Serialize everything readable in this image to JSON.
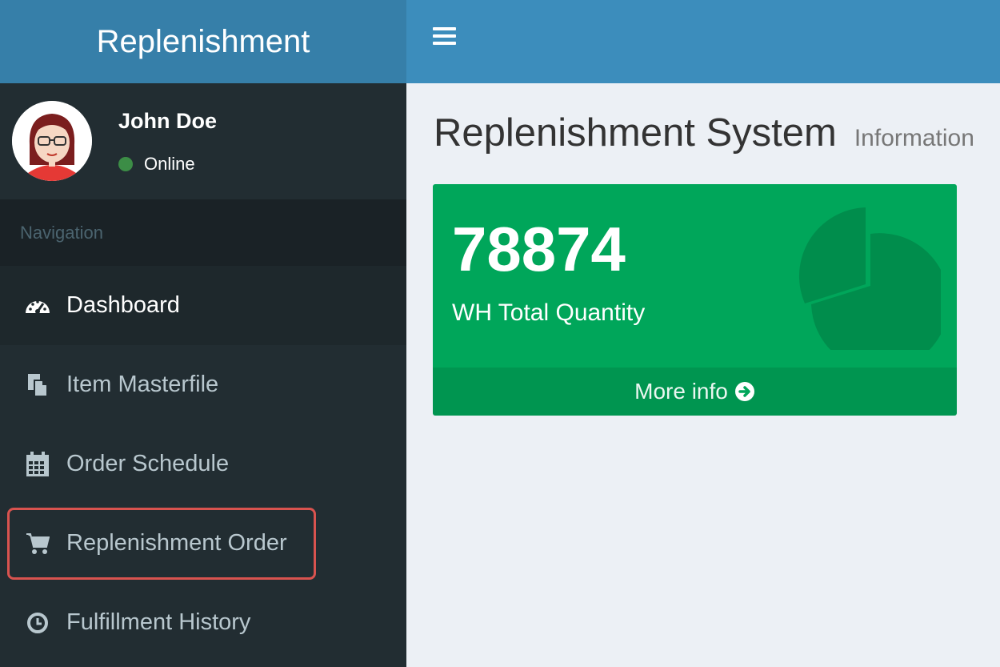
{
  "header": {
    "logo_text": "Replenishment"
  },
  "user": {
    "name": "John Doe",
    "status": "Online"
  },
  "sidebar": {
    "section_header": "Navigation",
    "items": [
      {
        "label": "Dashboard",
        "icon": "dashboard-icon"
      },
      {
        "label": "Item Masterfile",
        "icon": "files-icon"
      },
      {
        "label": "Order Schedule",
        "icon": "calendar-icon"
      },
      {
        "label": "Replenishment Order",
        "icon": "cart-icon"
      },
      {
        "label": "Fulfillment History",
        "icon": "clock-icon"
      }
    ]
  },
  "content": {
    "title": "Replenishment System",
    "subtitle": "Information"
  },
  "stat_box": {
    "value": "78874",
    "label": "WH Total Quantity",
    "footer_label": "More info",
    "icon": "pie-chart-icon",
    "color": "#00a65a"
  },
  "colors": {
    "header_logo_bg": "#367fa9",
    "header_bg": "#3c8dbc",
    "sidebar_bg": "#222d32",
    "content_bg": "#ecf0f5",
    "highlight_border": "#d9534f"
  }
}
